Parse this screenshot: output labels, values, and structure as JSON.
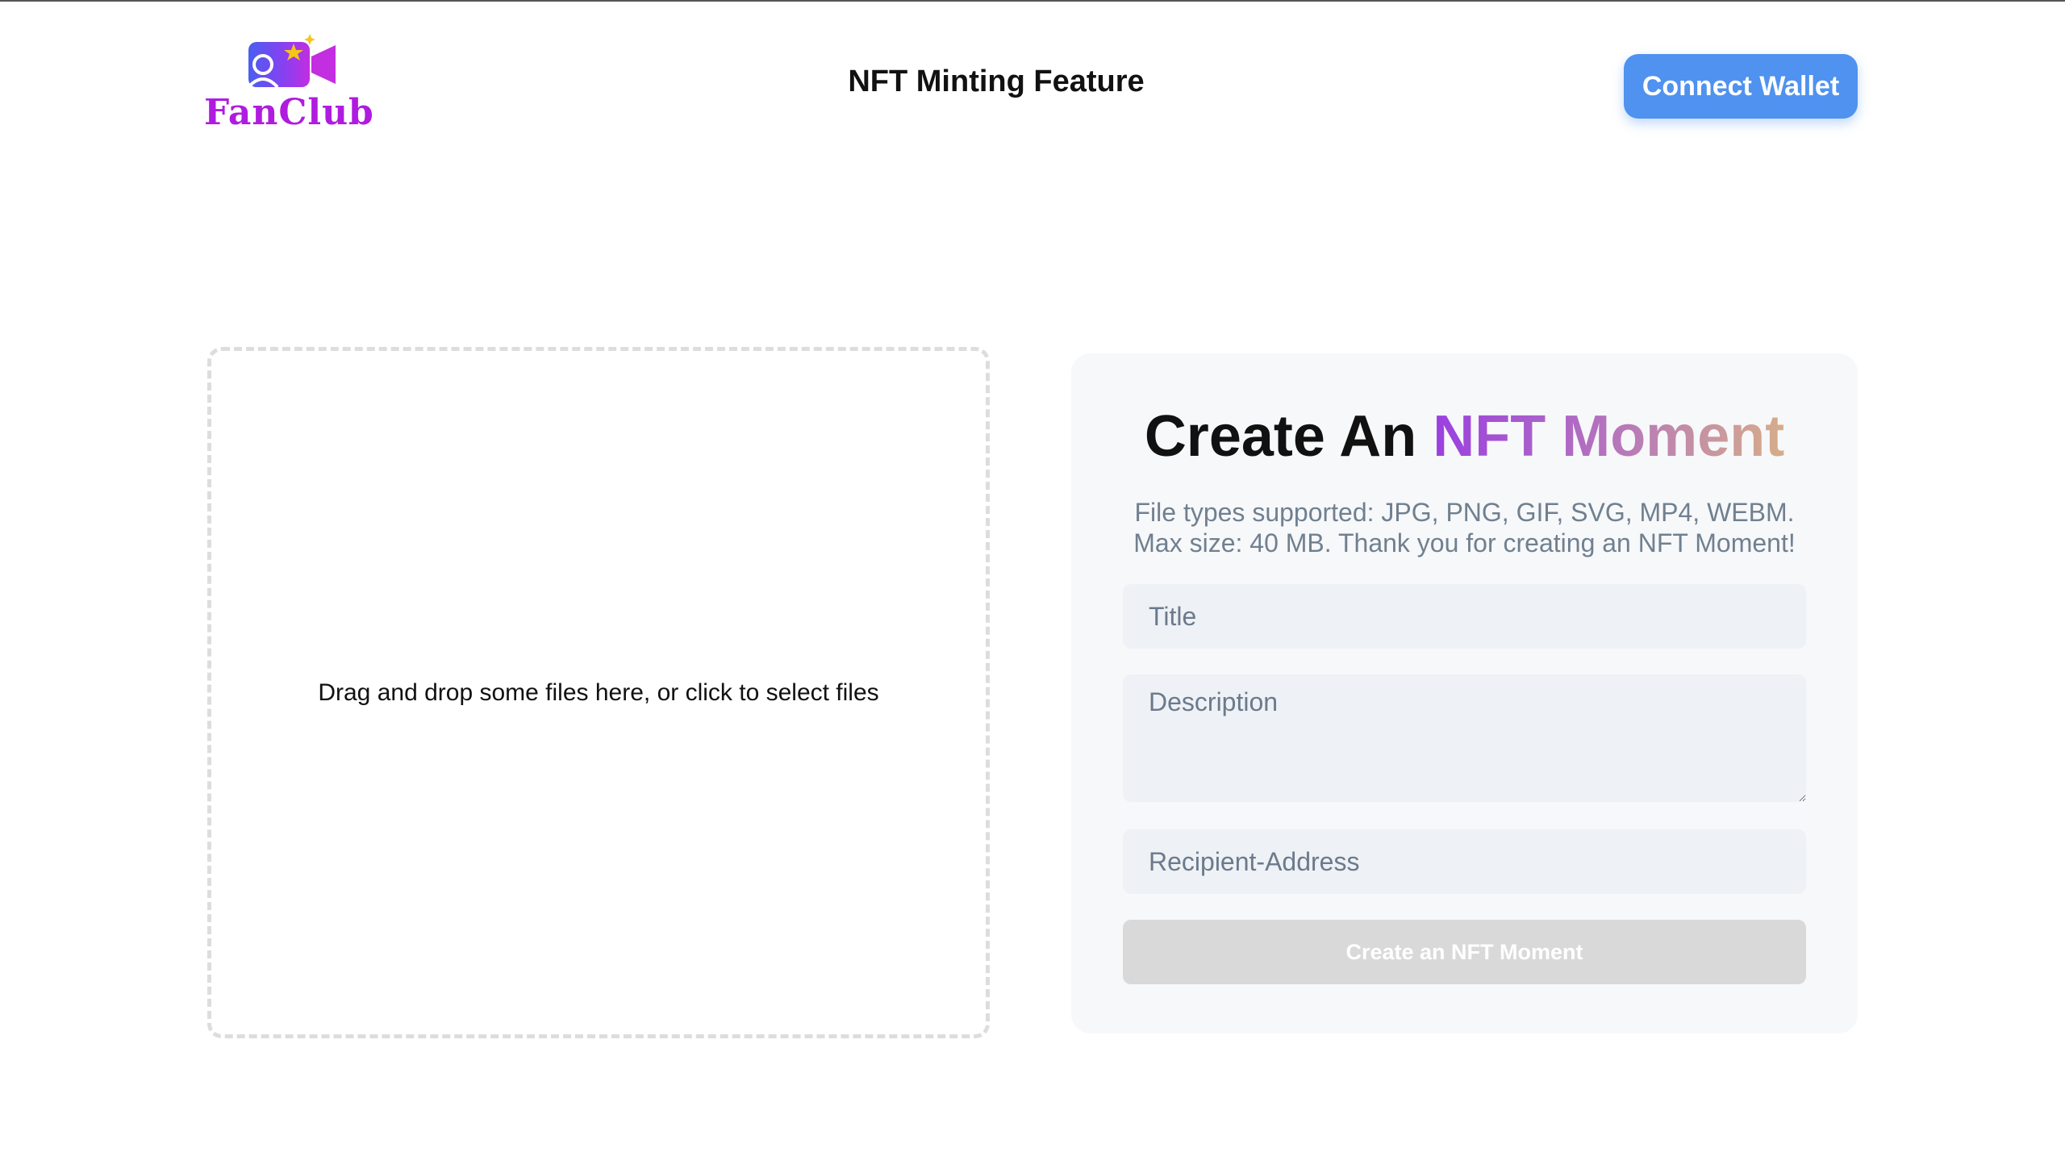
{
  "header": {
    "logo_text": "FanClub",
    "page_title": "NFT Minting Feature",
    "connect_wallet_label": "Connect Wallet"
  },
  "dropzone": {
    "prompt": "Drag and drop some files here, or click to select files"
  },
  "form": {
    "heading_prefix": "Create An ",
    "heading_highlight": "NFT Moment",
    "subtitle_line1": "File types supported: JPG, PNG, GIF, SVG, MP4, WEBM.",
    "subtitle_line2": "Max size: 40 MB. Thank you for creating an NFT Moment!",
    "title_placeholder": "Title",
    "description_placeholder": "Description",
    "recipient_placeholder": "Recipient-Address",
    "submit_label": "Create an NFT Moment"
  },
  "colors": {
    "brand": "#b01be0",
    "accent": "#4f92f0",
    "muted_text": "#708090",
    "disabled_button": "#d9d9d9"
  },
  "icons": {
    "logo": "video-camera-person-star-icon"
  }
}
